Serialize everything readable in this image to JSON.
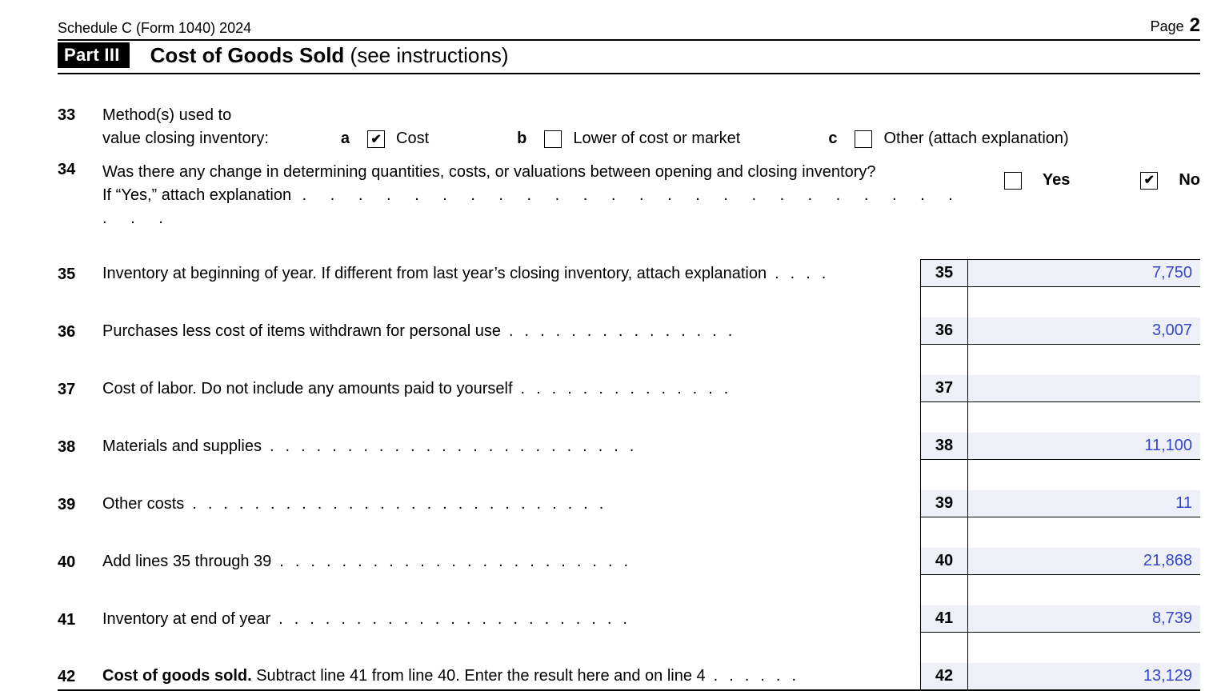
{
  "header": {
    "form_ref": "Schedule C (Form 1040) 2024",
    "page_label": "Page",
    "page_number": "2",
    "part_label": "Part III",
    "section_title_bold": "Cost of Goods Sold",
    "section_title_rest": " (see instructions)"
  },
  "line33": {
    "num": "33",
    "text_l1": "Method(s) used to",
    "text_l2": "value closing inventory:",
    "options": [
      {
        "letter": "a",
        "label": "Cost",
        "checked": true
      },
      {
        "letter": "b",
        "label": "Lower of cost or market",
        "checked": false
      },
      {
        "letter": "c",
        "label": "Other (attach explanation)",
        "checked": false
      }
    ]
  },
  "line34": {
    "num": "34",
    "q_line1": "Was there any change in determining quantities, costs, or valuations between opening and closing inventory?",
    "q_line2_lead": "If “Yes,” attach explanation",
    "yes_label": "Yes",
    "no_label": "No",
    "yes_checked": false,
    "no_checked": true
  },
  "rows": [
    {
      "num": "35",
      "text": "Inventory at beginning of year. If different from last year’s closing inventory, attach explanation",
      "dots": ".   .   .   .",
      "amount": "7,750"
    },
    {
      "num": "36",
      "text": "Purchases less cost of items withdrawn for personal use",
      "dots": ".   .   .   .   .   .   .   .   .   .   .   .   .   .   .",
      "amount": "3,007"
    },
    {
      "num": "37",
      "text": "Cost of labor. Do not include any amounts paid to yourself",
      "dots": ".   .   .   .   .   .   .   .   .   .   .   .   .   .",
      "amount": ""
    },
    {
      "num": "38",
      "text": "Materials and supplies",
      "dots": ".   .   .   .   .   .   .   .   .   .   .   .   .   .   .   .   .   .   .   .   .   .   .   .",
      "amount": "11,100"
    },
    {
      "num": "39",
      "text": "Other costs",
      "dots": ".   .   .   .   .   .   .   .   .   .   .   .   .   .   .   .   .   .   .   .   .   .   .   .   .   .   .",
      "amount": "11"
    },
    {
      "num": "40",
      "text": "Add lines 35 through 39",
      "dots": ".   .   .   .   .   .   .   .   .   .   .   .   .   .   .   .   .   .   .   .   .   .   .",
      "amount": "21,868"
    },
    {
      "num": "41",
      "text": "Inventory at end of year",
      "dots": ".   .   .   .   .   .   .   .   .   .   .   .   .   .   .   .   .   .   .   .   .   .   .",
      "amount": "8,739"
    },
    {
      "num": "42",
      "text_bold": "Cost of goods sold.",
      "text_rest": " Subtract line 41 from line 40. Enter the result here and on line 4",
      "dots": ".   .   .   .   .   .",
      "amount": "13,129"
    }
  ]
}
